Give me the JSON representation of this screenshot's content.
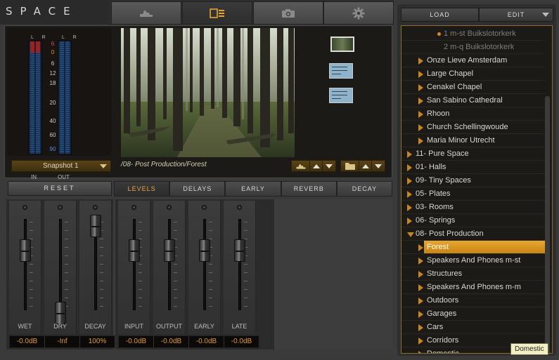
{
  "app": {
    "title": "SPACE"
  },
  "top_tabs": [
    {
      "name": "tab-eq-curve",
      "icon": "eq-curve-icon",
      "active": false
    },
    {
      "name": "tab-layout",
      "icon": "layout-list-icon",
      "active": true
    },
    {
      "name": "tab-camera",
      "icon": "camera-icon",
      "active": false
    },
    {
      "name": "tab-settings",
      "icon": "gear-icon",
      "active": false
    }
  ],
  "meters": {
    "left_channels": "L R",
    "right_channels": "L R",
    "scale": [
      "6",
      "0",
      "6",
      "12",
      "18",
      "20",
      "40",
      "60",
      "90"
    ],
    "in_label": "IN",
    "out_label": "OUT"
  },
  "thumbnails": [
    {
      "type": "photo"
    },
    {
      "type": "document"
    },
    {
      "type": "document"
    }
  ],
  "snapshot": {
    "selected": "Snapshot 1"
  },
  "path": "/08- Post Production/Forest",
  "reset_label": "RESET",
  "bottom_tabs": [
    {
      "label": "LEVELS",
      "active": true
    },
    {
      "label": "DELAYS",
      "active": false
    },
    {
      "label": "EARLY",
      "active": false
    },
    {
      "label": "REVERB",
      "active": false
    },
    {
      "label": "DECAY",
      "active": false
    }
  ],
  "mix_faders": [
    {
      "name": "WET",
      "value": "-0.0dB",
      "position": 0.72
    },
    {
      "name": "DRY",
      "value": "-Inf",
      "position": 0.0
    },
    {
      "name": "DECAY",
      "value": "100%",
      "position": 1.0
    }
  ],
  "level_faders": [
    {
      "name": "INPUT",
      "value": "-0.0dB",
      "position": 0.72
    },
    {
      "name": "OUTPUT",
      "value": "-0.0dB",
      "position": 0.72
    },
    {
      "name": "EARLY",
      "value": "-0.0dB",
      "position": 0.72
    },
    {
      "name": "LATE",
      "value": "-0.0dB",
      "position": 0.72
    }
  ],
  "browser": {
    "load_label": "LOAD",
    "edit_label": "EDIT",
    "tree": [
      {
        "label": "1 m-st Buikslotorkerk",
        "kind": "dot",
        "dim": true,
        "level": 3
      },
      {
        "label": "2 m-q Buikslotorkerk",
        "kind": "none",
        "dim": true,
        "level": 3
      },
      {
        "label": "Onze Lieve Amsterdam",
        "kind": "closed",
        "level": 2
      },
      {
        "label": "Large Chapel",
        "kind": "closed",
        "level": 2
      },
      {
        "label": "Cenakel Chapel",
        "kind": "closed",
        "level": 2
      },
      {
        "label": "San Sabino Cathedral",
        "kind": "closed",
        "level": 2
      },
      {
        "label": "Rhoon",
        "kind": "closed",
        "level": 2
      },
      {
        "label": "Church Schellingwoude",
        "kind": "closed",
        "level": 2
      },
      {
        "label": "Maria Minor Utrecht",
        "kind": "closed",
        "level": 2
      },
      {
        "label": "11- Pure Space",
        "kind": "closed",
        "level": 1
      },
      {
        "label": "01- Halls",
        "kind": "closed",
        "level": 1
      },
      {
        "label": "09- Tiny Spaces",
        "kind": "closed",
        "level": 1
      },
      {
        "label": "05- Plates",
        "kind": "closed",
        "level": 1
      },
      {
        "label": "03- Rooms",
        "kind": "closed",
        "level": 1
      },
      {
        "label": "06- Springs",
        "kind": "closed",
        "level": 1
      },
      {
        "label": "08- Post Production",
        "kind": "open",
        "level": 1
      },
      {
        "label": "Forest",
        "kind": "closed",
        "level": 2,
        "selected": true
      },
      {
        "label": "Speakers And Phones m-st",
        "kind": "closed",
        "level": 2
      },
      {
        "label": "Structures",
        "kind": "closed",
        "level": 2
      },
      {
        "label": "Speakers And Phones m-m",
        "kind": "closed",
        "level": 2
      },
      {
        "label": "Outdoors",
        "kind": "closed",
        "level": 2
      },
      {
        "label": "Garages",
        "kind": "closed",
        "level": 2
      },
      {
        "label": "Cars",
        "kind": "closed",
        "level": 2
      },
      {
        "label": "Corridors",
        "kind": "closed",
        "level": 2
      },
      {
        "label": "Domestic",
        "kind": "closed",
        "level": 2
      }
    ],
    "tooltip": "Domestic"
  },
  "colors": {
    "accent_orange": "#e8a631",
    "value_orange": "#e09a3b",
    "meter_blue": "#254a7a"
  }
}
